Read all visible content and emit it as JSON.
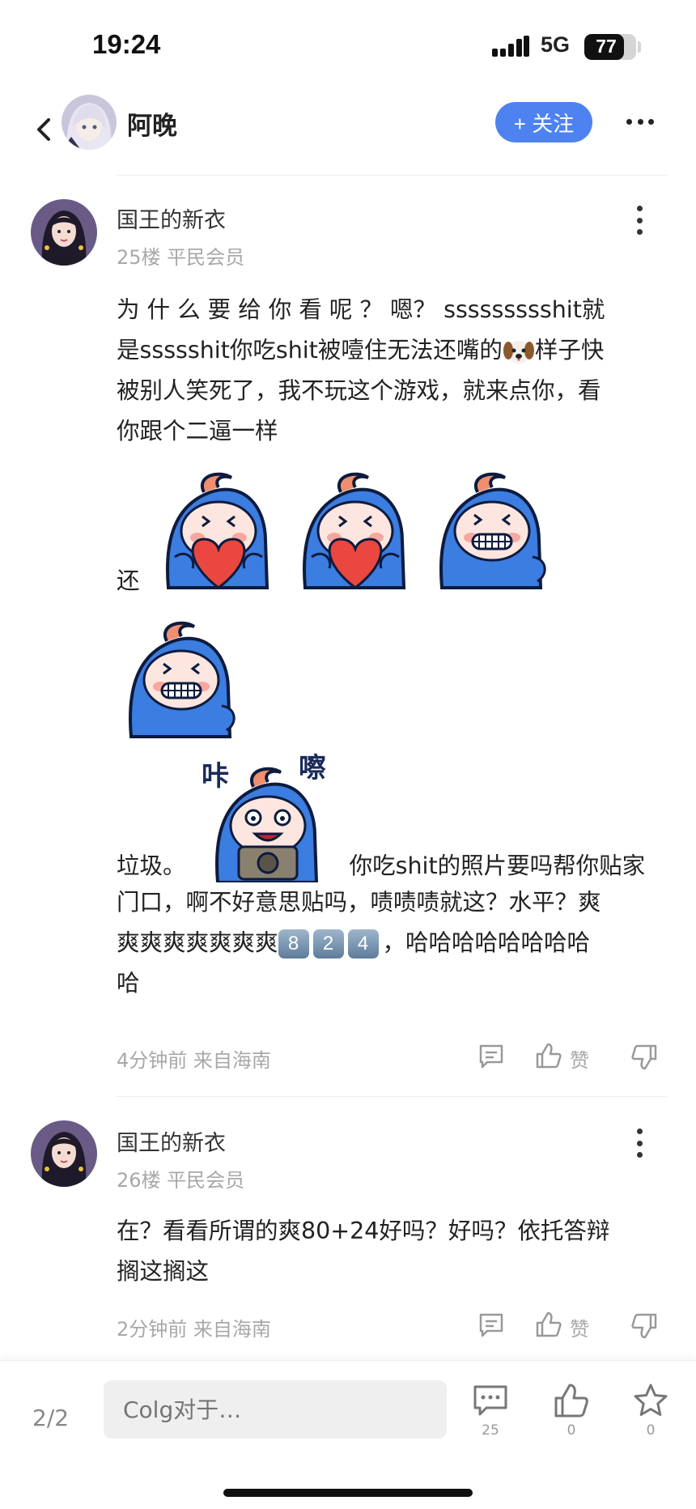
{
  "status_bar": {
    "time": "19:24",
    "network": "5G",
    "battery": "77",
    "battery_level": 0.77
  },
  "header": {
    "username": "阿晚",
    "follow_label": "+ 关注"
  },
  "posts": [
    {
      "username": "国王的新衣",
      "meta": "25楼 平民会员",
      "lines": [
        "为 什 么 要 给 你 看 呢 ？ 嗯？ ssssssssshit就",
        "是ssssshit你吃shit被噎住无法还嘴的",
        "样子快",
        "被别人笑死了，我不玩这个游戏，就来点你，看",
        "你跟个二逼一样",
        "还",
        "垃圾。",
        "你吃shit的照片要吗帮你贴家",
        "门口，啊不好意思贴吗，啧啧啧就这？水平？爽",
        "爽爽爽爽爽爽爽",
        "，哈哈哈哈哈哈哈哈",
        "哈"
      ],
      "keycaps": [
        "8",
        "2",
        "4"
      ],
      "sticker_caption": {
        "left": "咔",
        "right": "嚓"
      },
      "time_location": "4分钟前 来自海南",
      "like_label": "赞"
    },
    {
      "username": "国王的新衣",
      "meta": "26楼 平民会员",
      "lines": [
        "在？看看所谓的爽80+24好吗？好吗？依托答辩",
        "搁这搁这"
      ],
      "time_location": "2分钟前 来自海南",
      "like_label": "赞"
    }
  ],
  "bottom_bar": {
    "page_indicator": "2/2",
    "reply_placeholder": "Colg对于…",
    "comment_count": "25",
    "like_count": "0",
    "favorite_count": "0"
  },
  "colors": {
    "accent": "#4d82f0",
    "sticker_blue": "#3b7de0",
    "heart": "#e9473f",
    "muted": "#a8a8a8"
  },
  "icons": [
    "back-chevron-icon",
    "more-horizontal-icon",
    "more-vertical-icon",
    "comment-icon",
    "thumbs-up-icon",
    "thumbs-down-icon",
    "star-icon",
    "dog-emoji-icon"
  ]
}
